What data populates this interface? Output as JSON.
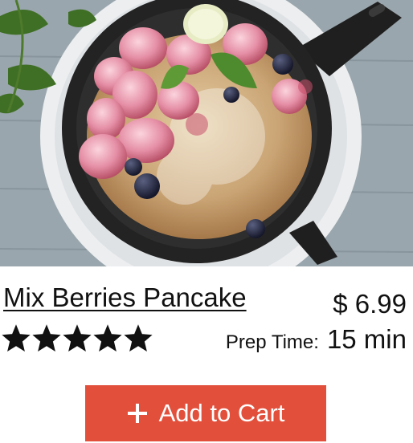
{
  "product": {
    "title": "Mix Berries Pancake",
    "price": "$ 6.99",
    "rating": 5,
    "rating_max": 5,
    "prep_label": "Prep Time:",
    "prep_value": "15 min"
  },
  "cart": {
    "label": "Add to Cart",
    "icon": "plus-icon",
    "color": "#e2503c"
  }
}
